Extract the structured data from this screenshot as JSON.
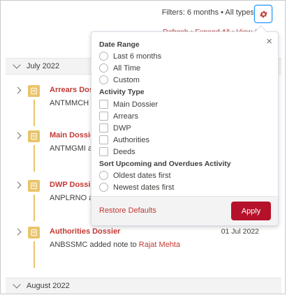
{
  "header": {
    "filters_label": "Filters: 6 months • All types",
    "gear_icon": "gear-icon",
    "actions_text": "Refresh • Expand All • View All"
  },
  "months": [
    {
      "label": "July 2022"
    },
    {
      "label": "August 2022"
    }
  ],
  "items": [
    {
      "title": "Arrears Dossier",
      "sub_prefix": "ANTMMCH",
      "sub_link": "",
      "date": ""
    },
    {
      "title": "Main Dossier",
      "sub_prefix": "ANTMGMI a",
      "sub_link": "",
      "date": ""
    },
    {
      "title": "DWP Dossier",
      "sub_prefix": "ANPLRNO a",
      "sub_link": "",
      "date": ""
    },
    {
      "title": "Authorities Dossier",
      "sub_prefix": "ANBSSMC added note to ",
      "sub_link": "Rajat Mehta",
      "date": "01 Jul 2022"
    }
  ],
  "popover": {
    "date_range": {
      "heading": "Date Range",
      "options": [
        "Last 6 months",
        "All Time",
        "Custom"
      ]
    },
    "activity_type": {
      "heading": "Activity Type",
      "options": [
        "Main Dossier",
        "Arrears",
        "DWP",
        "Authorities",
        "Deeds"
      ]
    },
    "sort": {
      "heading": "Sort Upcoming and Overdues Activity",
      "options": [
        "Oldest dates first",
        "Newest dates first"
      ]
    },
    "restore_label": "Restore Defaults",
    "apply_label": "Apply",
    "close_label": "×"
  },
  "colors": {
    "accent_red": "#c23934",
    "apply_button": "#b5112a",
    "icon_yellow": "#e9c46a",
    "focus_blue": "#1b96ff"
  }
}
